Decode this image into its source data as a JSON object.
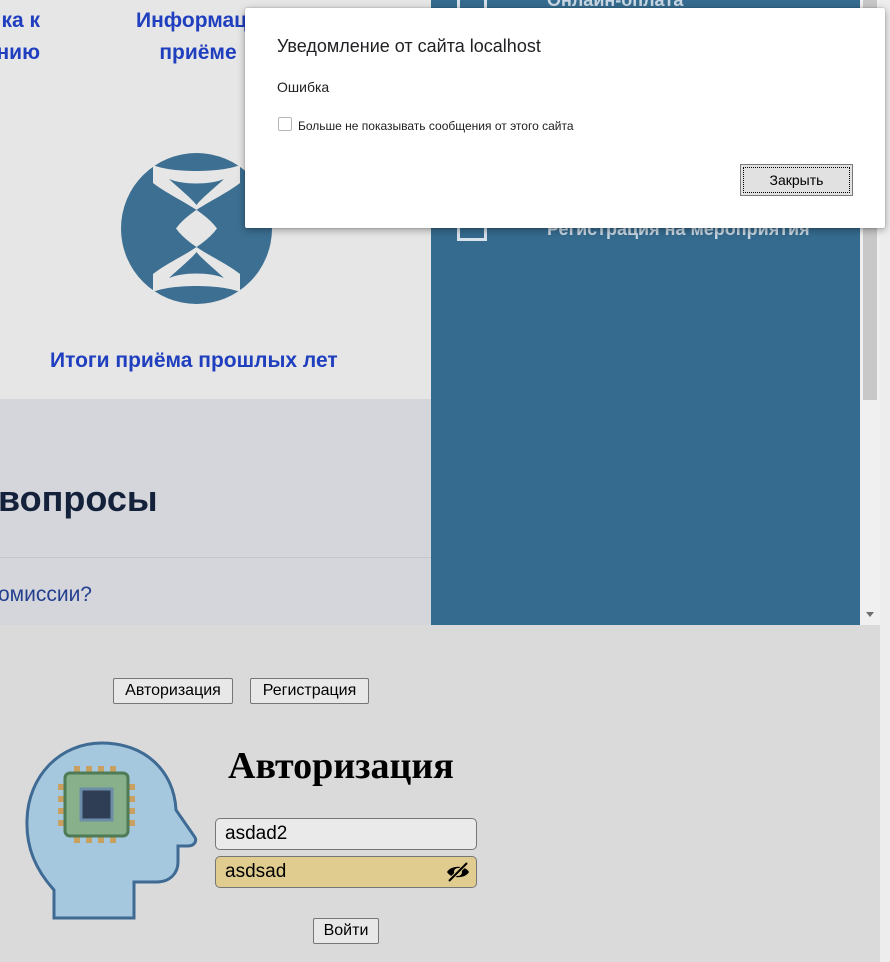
{
  "top_links": [
    {
      "line1": "ка к",
      "line2": "нию"
    },
    {
      "line1": "Информаци",
      "line2": "приёме"
    }
  ],
  "logo_icon": "hourglass-logo-icon",
  "results_link": "Итоги приёма прошлых лет",
  "faq": {
    "title": "вопросы",
    "question": "омиссии?"
  },
  "side_panel": {
    "items": [
      {
        "label": "Онлайн-оплата"
      },
      {
        "label": "Регистрация на мероприятия"
      }
    ]
  },
  "tabs": {
    "auth_label": "Авторизация",
    "reg_label": "Регистрация"
  },
  "login_form": {
    "title": "Авторизация",
    "login_value": "asdad2",
    "password_value": "asdsad",
    "password_toggle_icon": "eye-slash-icon",
    "submit_label": "Войти"
  },
  "avatar_icon": "head-chip-icon",
  "dialog": {
    "title": "Уведомление от сайта localhost",
    "message": "Ошибка",
    "checkbox_label": "Больше не показывать сообщения от этого сайта",
    "close_label": "Закрыть"
  },
  "colors": {
    "link": "#1f3fbf",
    "side_panel": "#356b8f",
    "password_bg": "#e0cc8e"
  }
}
